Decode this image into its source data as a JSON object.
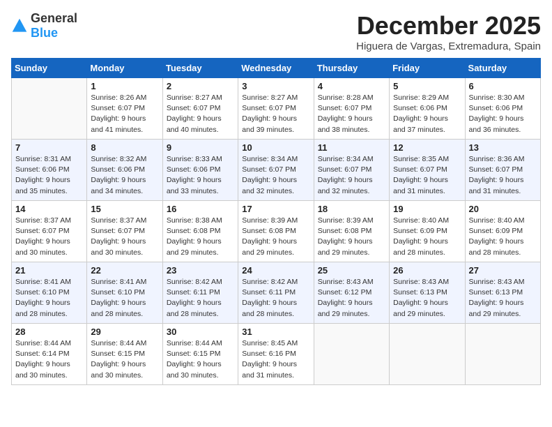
{
  "header": {
    "logo_general": "General",
    "logo_blue": "Blue",
    "month_title": "December 2025",
    "location": "Higuera de Vargas, Extremadura, Spain"
  },
  "weekdays": [
    "Sunday",
    "Monday",
    "Tuesday",
    "Wednesday",
    "Thursday",
    "Friday",
    "Saturday"
  ],
  "weeks": [
    [
      {
        "day": "",
        "sunrise": "",
        "sunset": "",
        "daylight": ""
      },
      {
        "day": "1",
        "sunrise": "Sunrise: 8:26 AM",
        "sunset": "Sunset: 6:07 PM",
        "daylight": "Daylight: 9 hours and 41 minutes."
      },
      {
        "day": "2",
        "sunrise": "Sunrise: 8:27 AM",
        "sunset": "Sunset: 6:07 PM",
        "daylight": "Daylight: 9 hours and 40 minutes."
      },
      {
        "day": "3",
        "sunrise": "Sunrise: 8:27 AM",
        "sunset": "Sunset: 6:07 PM",
        "daylight": "Daylight: 9 hours and 39 minutes."
      },
      {
        "day": "4",
        "sunrise": "Sunrise: 8:28 AM",
        "sunset": "Sunset: 6:07 PM",
        "daylight": "Daylight: 9 hours and 38 minutes."
      },
      {
        "day": "5",
        "sunrise": "Sunrise: 8:29 AM",
        "sunset": "Sunset: 6:06 PM",
        "daylight": "Daylight: 9 hours and 37 minutes."
      },
      {
        "day": "6",
        "sunrise": "Sunrise: 8:30 AM",
        "sunset": "Sunset: 6:06 PM",
        "daylight": "Daylight: 9 hours and 36 minutes."
      }
    ],
    [
      {
        "day": "7",
        "sunrise": "Sunrise: 8:31 AM",
        "sunset": "Sunset: 6:06 PM",
        "daylight": "Daylight: 9 hours and 35 minutes."
      },
      {
        "day": "8",
        "sunrise": "Sunrise: 8:32 AM",
        "sunset": "Sunset: 6:06 PM",
        "daylight": "Daylight: 9 hours and 34 minutes."
      },
      {
        "day": "9",
        "sunrise": "Sunrise: 8:33 AM",
        "sunset": "Sunset: 6:06 PM",
        "daylight": "Daylight: 9 hours and 33 minutes."
      },
      {
        "day": "10",
        "sunrise": "Sunrise: 8:34 AM",
        "sunset": "Sunset: 6:07 PM",
        "daylight": "Daylight: 9 hours and 32 minutes."
      },
      {
        "day": "11",
        "sunrise": "Sunrise: 8:34 AM",
        "sunset": "Sunset: 6:07 PM",
        "daylight": "Daylight: 9 hours and 32 minutes."
      },
      {
        "day": "12",
        "sunrise": "Sunrise: 8:35 AM",
        "sunset": "Sunset: 6:07 PM",
        "daylight": "Daylight: 9 hours and 31 minutes."
      },
      {
        "day": "13",
        "sunrise": "Sunrise: 8:36 AM",
        "sunset": "Sunset: 6:07 PM",
        "daylight": "Daylight: 9 hours and 31 minutes."
      }
    ],
    [
      {
        "day": "14",
        "sunrise": "Sunrise: 8:37 AM",
        "sunset": "Sunset: 6:07 PM",
        "daylight": "Daylight: 9 hours and 30 minutes."
      },
      {
        "day": "15",
        "sunrise": "Sunrise: 8:37 AM",
        "sunset": "Sunset: 6:07 PM",
        "daylight": "Daylight: 9 hours and 30 minutes."
      },
      {
        "day": "16",
        "sunrise": "Sunrise: 8:38 AM",
        "sunset": "Sunset: 6:08 PM",
        "daylight": "Daylight: 9 hours and 29 minutes."
      },
      {
        "day": "17",
        "sunrise": "Sunrise: 8:39 AM",
        "sunset": "Sunset: 6:08 PM",
        "daylight": "Daylight: 9 hours and 29 minutes."
      },
      {
        "day": "18",
        "sunrise": "Sunrise: 8:39 AM",
        "sunset": "Sunset: 6:08 PM",
        "daylight": "Daylight: 9 hours and 29 minutes."
      },
      {
        "day": "19",
        "sunrise": "Sunrise: 8:40 AM",
        "sunset": "Sunset: 6:09 PM",
        "daylight": "Daylight: 9 hours and 28 minutes."
      },
      {
        "day": "20",
        "sunrise": "Sunrise: 8:40 AM",
        "sunset": "Sunset: 6:09 PM",
        "daylight": "Daylight: 9 hours and 28 minutes."
      }
    ],
    [
      {
        "day": "21",
        "sunrise": "Sunrise: 8:41 AM",
        "sunset": "Sunset: 6:10 PM",
        "daylight": "Daylight: 9 hours and 28 minutes."
      },
      {
        "day": "22",
        "sunrise": "Sunrise: 8:41 AM",
        "sunset": "Sunset: 6:10 PM",
        "daylight": "Daylight: 9 hours and 28 minutes."
      },
      {
        "day": "23",
        "sunrise": "Sunrise: 8:42 AM",
        "sunset": "Sunset: 6:11 PM",
        "daylight": "Daylight: 9 hours and 28 minutes."
      },
      {
        "day": "24",
        "sunrise": "Sunrise: 8:42 AM",
        "sunset": "Sunset: 6:11 PM",
        "daylight": "Daylight: 9 hours and 28 minutes."
      },
      {
        "day": "25",
        "sunrise": "Sunrise: 8:43 AM",
        "sunset": "Sunset: 6:12 PM",
        "daylight": "Daylight: 9 hours and 29 minutes."
      },
      {
        "day": "26",
        "sunrise": "Sunrise: 8:43 AM",
        "sunset": "Sunset: 6:13 PM",
        "daylight": "Daylight: 9 hours and 29 minutes."
      },
      {
        "day": "27",
        "sunrise": "Sunrise: 8:43 AM",
        "sunset": "Sunset: 6:13 PM",
        "daylight": "Daylight: 9 hours and 29 minutes."
      }
    ],
    [
      {
        "day": "28",
        "sunrise": "Sunrise: 8:44 AM",
        "sunset": "Sunset: 6:14 PM",
        "daylight": "Daylight: 9 hours and 30 minutes."
      },
      {
        "day": "29",
        "sunrise": "Sunrise: 8:44 AM",
        "sunset": "Sunset: 6:15 PM",
        "daylight": "Daylight: 9 hours and 30 minutes."
      },
      {
        "day": "30",
        "sunrise": "Sunrise: 8:44 AM",
        "sunset": "Sunset: 6:15 PM",
        "daylight": "Daylight: 9 hours and 30 minutes."
      },
      {
        "day": "31",
        "sunrise": "Sunrise: 8:45 AM",
        "sunset": "Sunset: 6:16 PM",
        "daylight": "Daylight: 9 hours and 31 minutes."
      },
      {
        "day": "",
        "sunrise": "",
        "sunset": "",
        "daylight": ""
      },
      {
        "day": "",
        "sunrise": "",
        "sunset": "",
        "daylight": ""
      },
      {
        "day": "",
        "sunrise": "",
        "sunset": "",
        "daylight": ""
      }
    ]
  ]
}
